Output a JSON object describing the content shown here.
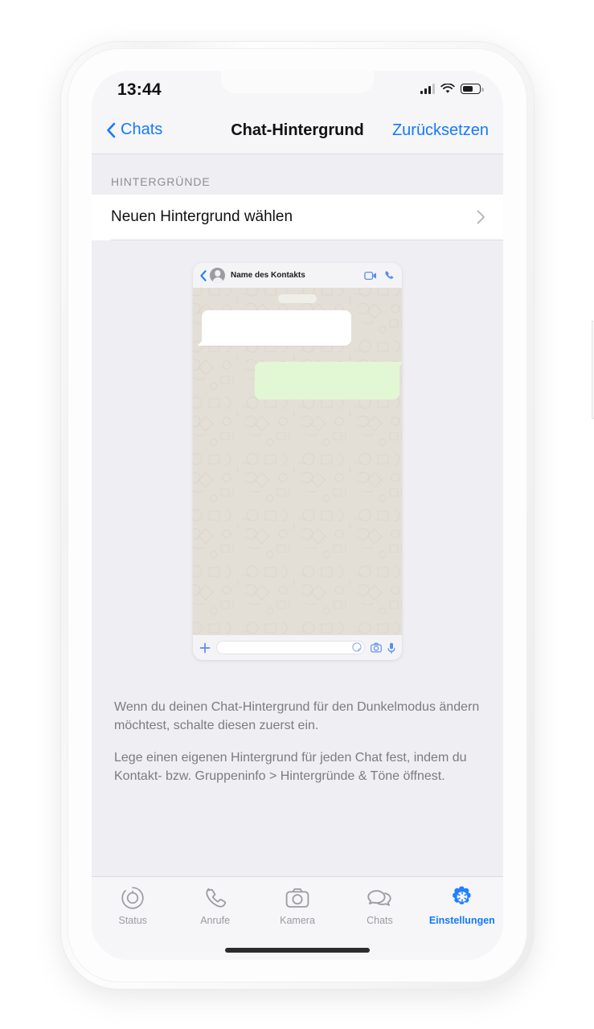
{
  "status_bar": {
    "time": "13:44",
    "signal_icon": "cellular-bars-icon",
    "wifi_icon": "wifi-icon",
    "battery_icon": "battery-icon",
    "battery_level_percent": 52
  },
  "nav_bar": {
    "back_icon": "chevron-left-icon",
    "back_label": "Chats",
    "title": "Chat-Hintergrund",
    "right_action_label": "Zurücksetzen"
  },
  "section": {
    "header": "HINTERGRÜNDE",
    "rows": [
      {
        "label": "Neuen Hintergrund wählen",
        "accessory_icon": "chevron-right-icon"
      }
    ]
  },
  "preview": {
    "header": {
      "back_icon": "chevron-left-icon",
      "avatar_icon": "contact-avatar-icon",
      "contact_name": "Name des Kontakts",
      "video_call_icon": "video-camera-icon",
      "voice_call_icon": "phone-icon"
    },
    "input_bar": {
      "attach_icon": "plus-icon",
      "text_field_placeholder": "",
      "sticker_icon": "sticker-icon",
      "camera_icon": "camera-icon",
      "mic_icon": "microphone-icon"
    },
    "wallpaper_color": "#e4dfd6",
    "incoming_bubble_color": "#ffffff",
    "outgoing_bubble_color": "#e2f7d4"
  },
  "footer_note": {
    "paragraph_1": "Wenn du deinen Chat-Hintergrund für den Dunkelmodus ändern möchtest, schalte diesen zuerst ein.",
    "paragraph_2": "Lege einen eigenen Hintergrund für jeden Chat fest, indem du Kontakt- bzw. Gruppeninfo > Hintergründe & Töne öffnest."
  },
  "tab_bar": {
    "active_index": 4,
    "accent_color": "#1479ff",
    "inactive_color": "#9b9ba1",
    "tabs": [
      {
        "label": "Status",
        "icon": "status-rings-icon"
      },
      {
        "label": "Anrufe",
        "icon": "phone-icon"
      },
      {
        "label": "Kamera",
        "icon": "camera-icon"
      },
      {
        "label": "Chats",
        "icon": "chat-bubbles-icon"
      },
      {
        "label": "Einstellungen",
        "icon": "gear-icon"
      }
    ]
  }
}
